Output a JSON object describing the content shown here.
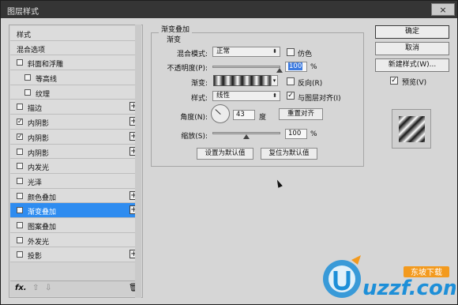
{
  "window": {
    "title": "图层样式",
    "close_label": "×"
  },
  "style_list": {
    "items": [
      {
        "label": "样式",
        "checkbox": false,
        "checked": false,
        "plus": false,
        "indent": 0,
        "selected": false
      },
      {
        "label": "混合选项",
        "checkbox": false,
        "checked": false,
        "plus": false,
        "indent": 0,
        "selected": false
      },
      {
        "label": "斜面和浮雕",
        "checkbox": true,
        "checked": false,
        "plus": false,
        "indent": 0,
        "selected": false
      },
      {
        "label": "等高线",
        "checkbox": true,
        "checked": false,
        "plus": false,
        "indent": 1,
        "selected": false
      },
      {
        "label": "纹理",
        "checkbox": true,
        "checked": false,
        "plus": false,
        "indent": 1,
        "selected": false
      },
      {
        "label": "描边",
        "checkbox": true,
        "checked": false,
        "plus": true,
        "indent": 0,
        "selected": false
      },
      {
        "label": "内阴影",
        "checkbox": true,
        "checked": true,
        "plus": true,
        "indent": 0,
        "selected": false
      },
      {
        "label": "内阴影",
        "checkbox": true,
        "checked": true,
        "plus": true,
        "indent": 0,
        "selected": false
      },
      {
        "label": "内阴影",
        "checkbox": true,
        "checked": false,
        "plus": true,
        "indent": 0,
        "selected": false
      },
      {
        "label": "内发光",
        "checkbox": true,
        "checked": false,
        "plus": false,
        "indent": 0,
        "selected": false
      },
      {
        "label": "光泽",
        "checkbox": true,
        "checked": false,
        "plus": false,
        "indent": 0,
        "selected": false
      },
      {
        "label": "颜色叠加",
        "checkbox": true,
        "checked": false,
        "plus": true,
        "indent": 0,
        "selected": false
      },
      {
        "label": "渐变叠加",
        "checkbox": true,
        "checked": true,
        "plus": true,
        "indent": 0,
        "selected": true
      },
      {
        "label": "图案叠加",
        "checkbox": true,
        "checked": false,
        "plus": false,
        "indent": 0,
        "selected": false
      },
      {
        "label": "外发光",
        "checkbox": true,
        "checked": false,
        "plus": false,
        "indent": 0,
        "selected": false
      },
      {
        "label": "投影",
        "checkbox": true,
        "checked": false,
        "plus": true,
        "indent": 0,
        "selected": false
      }
    ],
    "footer": {
      "fx": "fx.",
      "up": "⇧",
      "down": "⇩",
      "trash": "🗑"
    }
  },
  "gradient_overlay": {
    "group_title": "渐变叠加",
    "sub_title": "渐变",
    "blend_mode_label": "混合模式:",
    "blend_mode_value": "正常",
    "dither_label": "仿色",
    "dither_checked": false,
    "opacity_label": "不透明度(P):",
    "opacity_value": "100",
    "opacity_level": 1.0,
    "opacity_unit": "%",
    "gradient_label": "渐变:",
    "reverse_label": "反向(R)",
    "reverse_checked": false,
    "style_label": "样式:",
    "style_value": "线性",
    "align_label": "与图层对齐(I)",
    "align_checked": true,
    "angle_label": "角度(N):",
    "angle_value": "43",
    "angle_unit": "度",
    "reset_align_label": "重置对齐",
    "scale_label": "缩放(S):",
    "scale_value": "100",
    "scale_level": 0.5,
    "scale_unit": "%",
    "make_default_label": "设置为默认值",
    "reset_default_label": "复位为默认值"
  },
  "actions": {
    "ok_label": "确定",
    "cancel_label": "取消",
    "new_style_label": "新建样式(W)...",
    "preview_label": "预览(V)",
    "preview_checked": true
  },
  "watermark": {
    "brand": "uzzf.com",
    "tag": "东坡下载"
  }
}
